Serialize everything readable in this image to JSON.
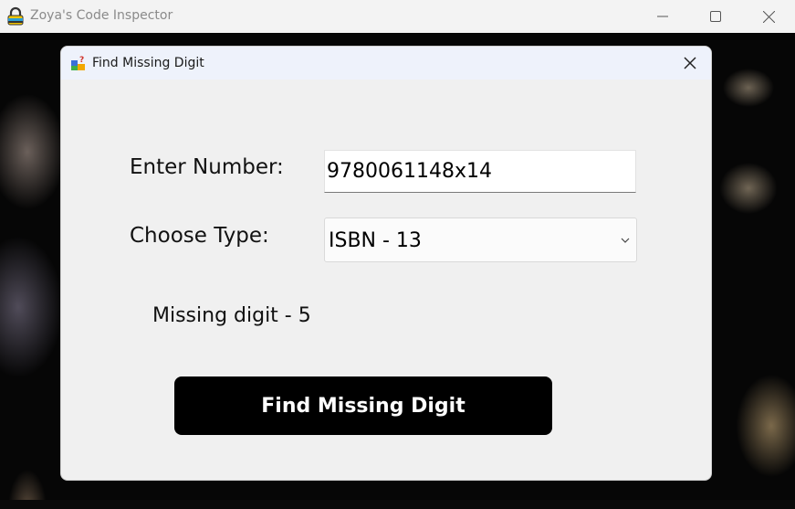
{
  "window": {
    "title": "Zoya's Code Inspector",
    "icon": "padlock-icon"
  },
  "dialog": {
    "title": "Find Missing Digit",
    "icon": "puzzle-icon",
    "number_label": "Enter Number:",
    "number_value": "9780061148x14",
    "type_label": "Choose Type:",
    "type_value": "ISBN - 13",
    "result_text": "Missing digit - 5",
    "find_button_label": "Find Missing Digit"
  },
  "colors": {
    "button_bg": "#000000",
    "button_text": "#ffffff",
    "dialog_bg": "#f0f0f0"
  }
}
